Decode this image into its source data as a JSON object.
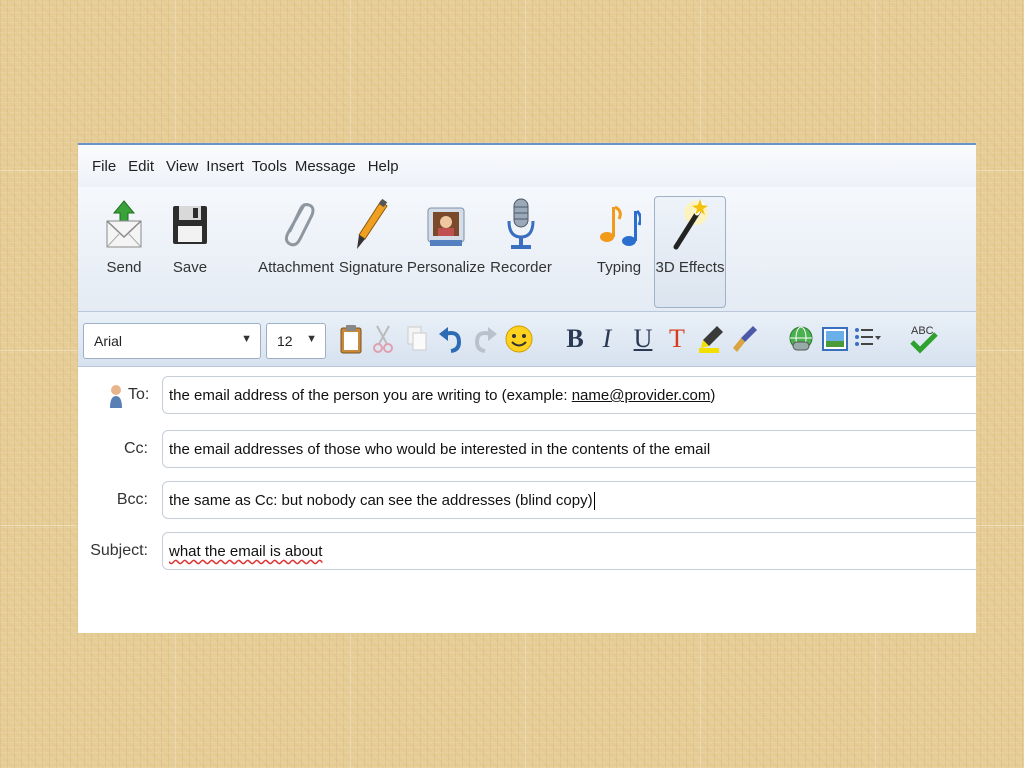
{
  "menu": [
    "File",
    "Edit",
    "View",
    "Insert",
    "Tools",
    "Message",
    "Help"
  ],
  "toolbar": {
    "send": "Send",
    "save": "Save",
    "attachment": "Attachment",
    "signature": "Signature",
    "personalize": "Personalize",
    "recorder": "Recorder",
    "typing": "Typing",
    "effects": "3D Effects"
  },
  "format": {
    "font": "Arial",
    "size": "12",
    "bold": "B",
    "italic": "I",
    "underline": "U",
    "text_color": "T",
    "spellcheck": "ABC"
  },
  "fields": {
    "to_label": "To:",
    "to_value_prefix": "the email address of the person you are writing to (example: ",
    "to_value_link": "name@provider.com",
    "to_value_suffix": ")",
    "cc_label": "Cc:",
    "cc_value": "the email addresses of those who would be interested in the contents of the email",
    "bcc_label": "Bcc:",
    "bcc_value": "the same as Cc: but nobody can see the addresses (blind copy)",
    "subject_label": "Subject:",
    "subject_value": "what the email is about"
  },
  "colors": {
    "accent": "#6a93c9",
    "background": "#e6cd96"
  }
}
